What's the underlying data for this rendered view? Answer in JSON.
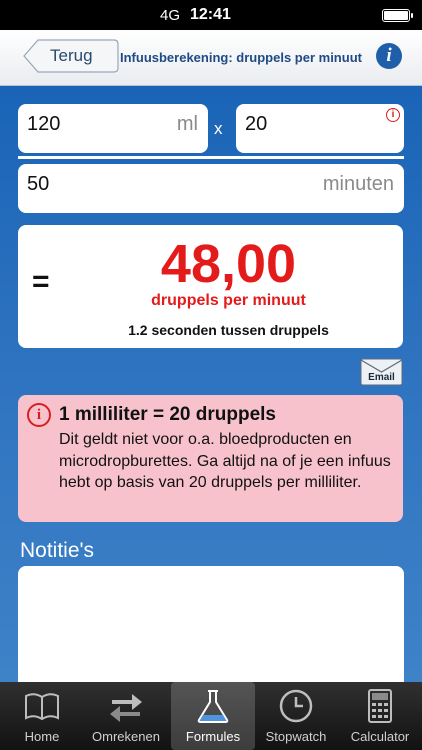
{
  "status_bar": {
    "network": "4G",
    "time": "12:41"
  },
  "nav": {
    "back_label": "Terug",
    "title": "Infuusberekening: druppels per minuut",
    "info_icon": "info-icon"
  },
  "inputs": {
    "volume": {
      "value": "120",
      "unit": "ml"
    },
    "multiplier": {
      "symbol": "x",
      "value": "20"
    },
    "duration": {
      "value": "50",
      "unit": "minuten"
    }
  },
  "result": {
    "equals": "=",
    "value": "48,00",
    "unit": "druppels per minuut",
    "interval": "1.2 seconden tussen druppels",
    "accent_color": "#e41b1b"
  },
  "email_button": {
    "label": "Email"
  },
  "notice": {
    "title": "1 milliliter = 20 druppels",
    "body": "Dit geldt niet voor o.a. bloedproducten en microdropburettes. Ga altijd na of je een infuus hebt op basis van 20 druppels per milliliter."
  },
  "notes": {
    "label": "Notitie's"
  },
  "tabs": [
    {
      "label": "Home",
      "icon": "book-icon"
    },
    {
      "label": "Omrekenen",
      "icon": "arrows-icon"
    },
    {
      "label": "Formules",
      "icon": "flask-icon",
      "active": true
    },
    {
      "label": "Stopwatch",
      "icon": "clock-icon"
    },
    {
      "label": "Calculator",
      "icon": "calculator-icon"
    }
  ]
}
